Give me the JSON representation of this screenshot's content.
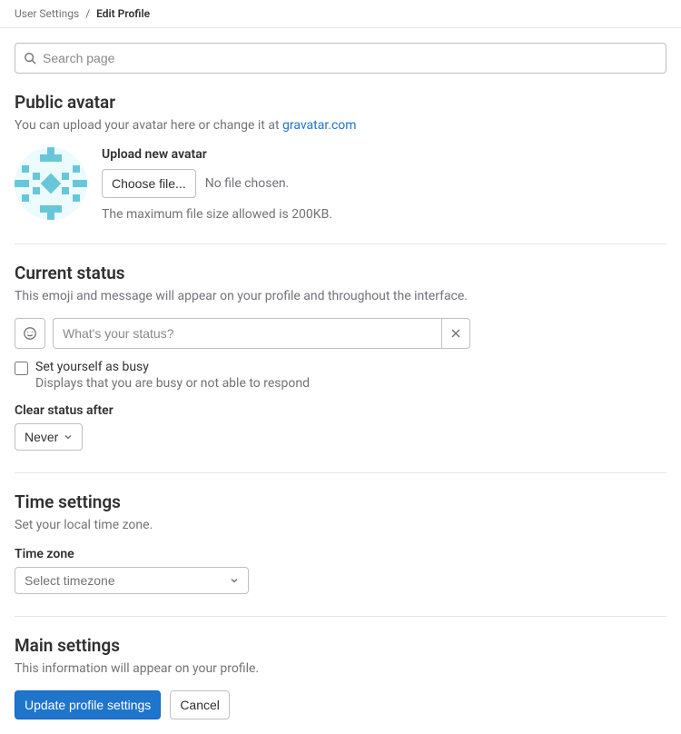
{
  "breadcrumb": {
    "parent": "User Settings",
    "separator": "/",
    "current": "Edit Profile"
  },
  "search": {
    "placeholder": "Search page"
  },
  "avatar": {
    "title": "Public avatar",
    "desc_prefix": "You can upload your avatar here or change it at ",
    "gravatar_link": "gravatar.com",
    "upload_label": "Upload new avatar",
    "choose_file_btn": "Choose file...",
    "no_file": "No file chosen.",
    "max_size": "The maximum file size allowed is 200KB."
  },
  "status": {
    "title": "Current status",
    "desc": "This emoji and message will appear on your profile and throughout the interface.",
    "placeholder": "What's your status?",
    "busy_label": "Set yourself as busy",
    "busy_help": "Displays that you are busy or not able to respond",
    "clear_after_label": "Clear status after",
    "clear_after_value": "Never"
  },
  "time": {
    "title": "Time settings",
    "desc": "Set your local time zone.",
    "tz_label": "Time zone",
    "tz_placeholder": "Select timezone"
  },
  "main": {
    "title": "Main settings",
    "desc": "This information will appear on your profile."
  },
  "actions": {
    "update": "Update profile settings",
    "cancel": "Cancel"
  }
}
